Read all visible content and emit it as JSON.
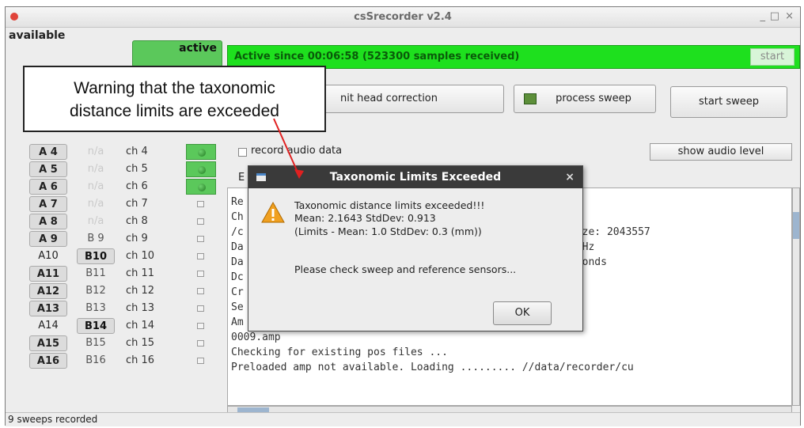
{
  "window": {
    "title": "csSrecorder v2.4",
    "minimize": "_",
    "maximize": "□",
    "close": "×"
  },
  "sidebar": {
    "available_label": "available",
    "active_label": "active",
    "rows": [
      {
        "a": "A 4",
        "a_boxed": true,
        "b": "n/a",
        "b_na": true,
        "b_boxed": false,
        "ch": "ch 4",
        "active": true
      },
      {
        "a": "A 5",
        "a_boxed": true,
        "b": "n/a",
        "b_na": true,
        "b_boxed": false,
        "ch": "ch 5",
        "active": true
      },
      {
        "a": "A 6",
        "a_boxed": true,
        "b": "n/a",
        "b_na": true,
        "b_boxed": false,
        "ch": "ch 6",
        "active": true
      },
      {
        "a": "A 7",
        "a_boxed": true,
        "b": "n/a",
        "b_na": true,
        "b_boxed": false,
        "ch": "ch 7",
        "active": false
      },
      {
        "a": "A 8",
        "a_boxed": true,
        "b": "n/a",
        "b_na": true,
        "b_boxed": false,
        "ch": "ch 8",
        "active": false
      },
      {
        "a": "A 9",
        "a_boxed": true,
        "b": "B 9",
        "b_na": false,
        "b_boxed": false,
        "ch": "ch 9",
        "active": false
      },
      {
        "a": "A10",
        "a_boxed": false,
        "b": "B10",
        "b_na": false,
        "b_boxed": true,
        "ch": "ch 10",
        "active": false
      },
      {
        "a": "A11",
        "a_boxed": true,
        "b": "B11",
        "b_na": false,
        "b_boxed": false,
        "ch": "ch 11",
        "active": false
      },
      {
        "a": "A12",
        "a_boxed": true,
        "b": "B12",
        "b_na": false,
        "b_boxed": false,
        "ch": "ch 12",
        "active": false
      },
      {
        "a": "A13",
        "a_boxed": true,
        "b": "B13",
        "b_na": false,
        "b_boxed": false,
        "ch": "ch 13",
        "active": false
      },
      {
        "a": "A14",
        "a_boxed": false,
        "b": "B14",
        "b_na": false,
        "b_boxed": true,
        "ch": "ch 14",
        "active": false
      },
      {
        "a": "A15",
        "a_boxed": true,
        "b": "B15",
        "b_na": false,
        "b_boxed": false,
        "ch": "ch 15",
        "active": false
      },
      {
        "a": "A16",
        "a_boxed": true,
        "b": "B16",
        "b_na": false,
        "b_boxed": false,
        "ch": "ch 16",
        "active": false
      }
    ]
  },
  "status": {
    "active_text": "Active since 00:06:58 (523300 samples received)",
    "start_label": "start"
  },
  "toolbar": {
    "head_correction_label": "nit head correction",
    "process_sweep_label": "process sweep",
    "start_sweep_label": "start sweep",
    "record_audio_label": "record audio data",
    "show_audio_label": "show audio level",
    "partial_label": "E"
  },
  "log": {
    "lines": [
      "Re",
      "Ch",
      "/c",
      "Da",
      "Da",
      "Dc",
      "Cr",
      "Se",
      "Am",
      "0009.amp",
      "Checking for existing pos files ...",
      "Preloaded amp not available. Loading ......... //data/recorder/cu"
    ],
    "right_fragments": {
      "size": "Size: 2043557",
      "hz": "50Hz",
      "seconds": "econds"
    }
  },
  "dialog": {
    "title": "Taxonomic Limits Exceeded",
    "close": "×",
    "line1": "Taxonomic distance limits exceeded!!!",
    "line2": "Mean: 2.1643 StdDev: 0.913",
    "line3": "(Limits - Mean: 1.0 StdDev: 0.3 (mm))",
    "line4": "Please check sweep and reference sensors...",
    "ok_label": "OK"
  },
  "callout": {
    "line1": "Warning that the taxonomic",
    "line2": "distance limits are exceeded"
  },
  "footer": {
    "status": "9 sweeps recorded"
  },
  "colors": {
    "active_green": "#1ee01e",
    "led_green": "#2e9e2e",
    "annotation_arrow": "#e02020"
  }
}
